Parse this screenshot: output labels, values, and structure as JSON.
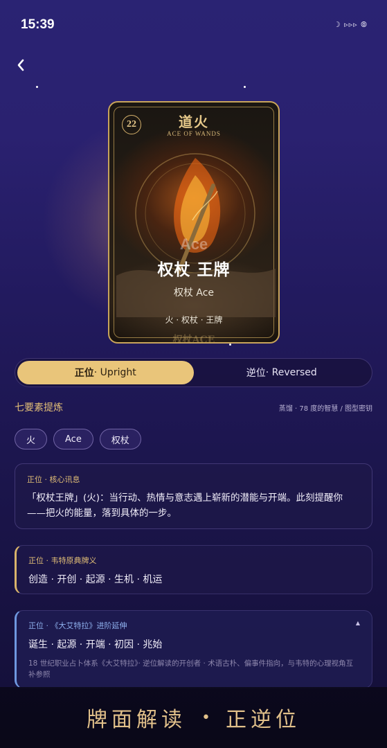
{
  "status_bar": {
    "time": "15:39",
    "icons_text": "☽ ▹▹▹ ⦾",
    "icons": [
      "moon-icon",
      "signal-icon",
      "battery-icon"
    ]
  },
  "nav": {
    "back_icon": "chevron-left-icon"
  },
  "card": {
    "number": "22",
    "title_cn": "道火",
    "title_en": "ACE OF WANDS",
    "ghost_en": "Ace",
    "name": "权杖  王牌",
    "subtitle": "权杖 Ace",
    "tags": "火 · 权杖 · 王牌",
    "bottom_ghost": "权杖ACE"
  },
  "toggle": {
    "upright_cn": "正位",
    "upright_en": " · Upright",
    "reversed_cn": "逆位",
    "reversed_en": " · Reversed",
    "selected": "upright"
  },
  "elements_section": {
    "title": "七要素提炼",
    "meta": "蒸馏 · 78 度的智慧 / 图型密钥",
    "chips": [
      "火",
      "Ace",
      "权杖"
    ]
  },
  "core_message": {
    "label": "正位 · 核心讯息",
    "body": "「权杖王牌」(火)：当行动、热情与意志遇上崭新的潜能与开端。此刻提醒你——把火的能量，落到具体的一步。"
  },
  "waite_meaning": {
    "label": "正位 · 韦特原典牌义",
    "body": "创造 · 开创 · 起源 · 生机 · 机运"
  },
  "etteilla": {
    "label": "正位 · 《大艾特拉》进阶延伸",
    "caret": "▲",
    "body": "诞生 · 起源 · 开端 · 初因 · 兆始",
    "note": "18 世纪职业占卜体系《大艾特拉》· 逆位解读的开创者 · 术语古朴、偏事件指向，与韦特的心理视角互补参照"
  },
  "footer": {
    "left": "牌面解读",
    "dot": "•",
    "right": "正逆位"
  },
  "colors": {
    "accent_gold": "#e9c57a",
    "label_gold": "#e3bf77",
    "etteilla_blue": "#6f98e0",
    "background_top": "#2a2373",
    "background_bottom": "#130f36"
  }
}
